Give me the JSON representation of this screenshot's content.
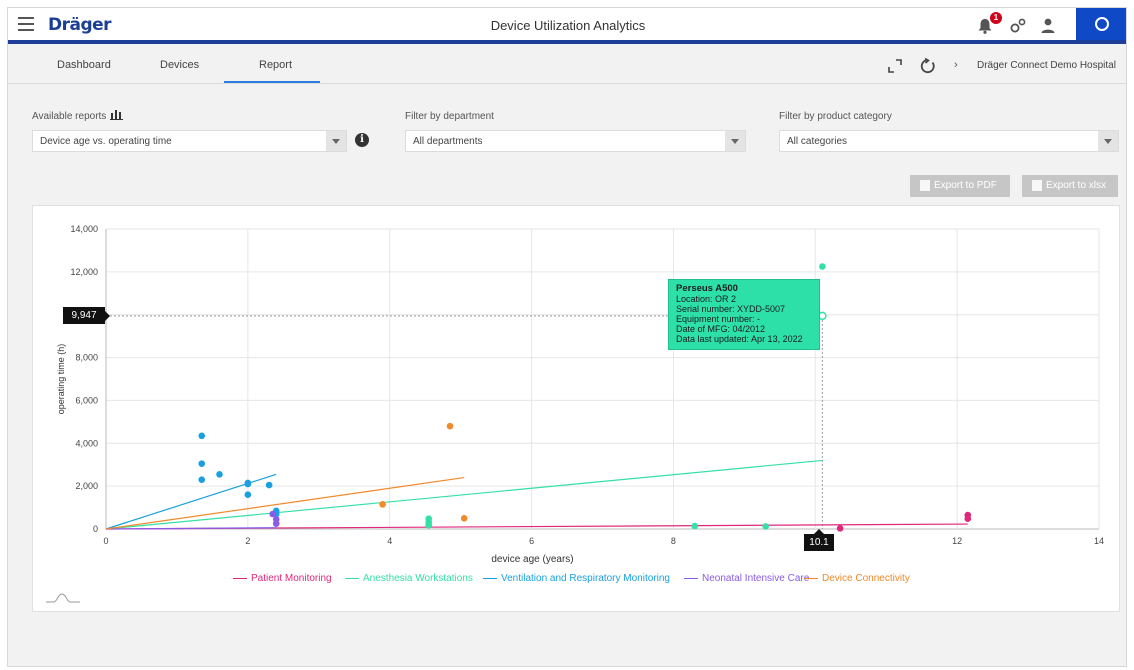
{
  "app": {
    "logo": "Dräger",
    "title": "Device Utilization Analytics",
    "notification_count": "1"
  },
  "tabs": [
    {
      "label": "Dashboard"
    },
    {
      "label": "Devices"
    },
    {
      "label": "Report",
      "active": true
    }
  ],
  "breadcrumb": {
    "label": "Dräger Connect Demo Hospital"
  },
  "filters": {
    "reports_label": "Available reports",
    "report_value": "Device age vs. operating time",
    "department_label": "Filter by department",
    "department_value": "All departments",
    "category_label": "Filter by product category",
    "category_value": "All categories"
  },
  "export": {
    "pdf": "Export to PDF",
    "xlsx": "Export to xlsx"
  },
  "colors": {
    "brand": "#1b3f92",
    "accent_blue": "#0f49c6",
    "tab_underline": "#2a7de1",
    "patient_monitoring": "#e0287a",
    "anesthesia": "#34e0a6",
    "ventilation": "#1aa0e0",
    "neonatal": "#8a5be8",
    "connectivity": "#f08a2a"
  },
  "icons": {
    "menu": "hamburger-icon",
    "notifications": "bell-icon",
    "settings": "gears-icon",
    "profile": "user-icon",
    "power": "circle-icon",
    "expand": "expand-icon",
    "refresh": "refresh-icon",
    "report_type": "bar-chart-icon",
    "info": "info-icon"
  },
  "chart_data": {
    "type": "scatter",
    "xlabel": "device age (years)",
    "ylabel": "operating time (h)",
    "xlim": [
      0,
      14
    ],
    "ylim": [
      0,
      14000
    ],
    "x_ticks": [
      "0",
      "2",
      "4",
      "6",
      "8",
      "10",
      "12",
      "14"
    ],
    "y_ticks": [
      "0",
      "2,000",
      "4,000",
      "6,000",
      "8,000",
      "10,000",
      "12,000",
      "14,000"
    ],
    "grid": true,
    "legend_position": "bottom",
    "series": [
      {
        "name": "Patient Monitoring",
        "color": "#e0287a",
        "points": [
          [
            12.15,
            650
          ],
          [
            12.15,
            480
          ],
          [
            10.35,
            30
          ]
        ],
        "trend": [
          [
            0,
            0
          ],
          [
            12.15,
            230
          ]
        ]
      },
      {
        "name": "Anesthesia Workstations",
        "color": "#34e0a6",
        "points": [
          [
            10.1,
            12250
          ],
          [
            10.1,
            9947
          ],
          [
            4.55,
            480
          ],
          [
            4.55,
            320
          ],
          [
            4.55,
            180
          ],
          [
            8.3,
            140
          ],
          [
            9.3,
            120
          ]
        ],
        "trend": [
          [
            0,
            0
          ],
          [
            10.1,
            3200
          ]
        ]
      },
      {
        "name": "Ventilation and Respiratory Monitoring",
        "color": "#1aa0e0",
        "points": [
          [
            1.35,
            4350
          ],
          [
            1.35,
            3050
          ],
          [
            1.35,
            2300
          ],
          [
            1.6,
            2550
          ],
          [
            2.0,
            2150
          ],
          [
            2.0,
            2100
          ],
          [
            2.0,
            1600
          ],
          [
            2.3,
            2050
          ],
          [
            2.4,
            850
          ],
          [
            2.4,
            700
          ]
        ],
        "trend": [
          [
            0,
            0
          ],
          [
            2.4,
            2550
          ]
        ]
      },
      {
        "name": "Neonatal Intensive Care",
        "color": "#8a5be8",
        "points": [
          [
            2.35,
            700
          ],
          [
            2.4,
            450
          ],
          [
            2.4,
            250
          ]
        ],
        "trend": [
          [
            0,
            0
          ],
          [
            2.4,
            60
          ]
        ]
      },
      {
        "name": "Device Connectivity",
        "color": "#f08a2a",
        "points": [
          [
            4.85,
            4800
          ],
          [
            3.9,
            1150
          ],
          [
            5.05,
            500
          ]
        ],
        "trend": [
          [
            0,
            0
          ],
          [
            5.05,
            2400
          ]
        ]
      }
    ],
    "crosshair": {
      "x_label": "10.1",
      "y_label": "9,947"
    },
    "tooltip": {
      "title": "Perseus A500",
      "lines": [
        "Location: OR 2",
        "Serial number: XYDD-5007",
        "Equipment number: -",
        "Date of MFG: 04/2012",
        "Data last updated: Apr 13, 2022"
      ]
    }
  }
}
